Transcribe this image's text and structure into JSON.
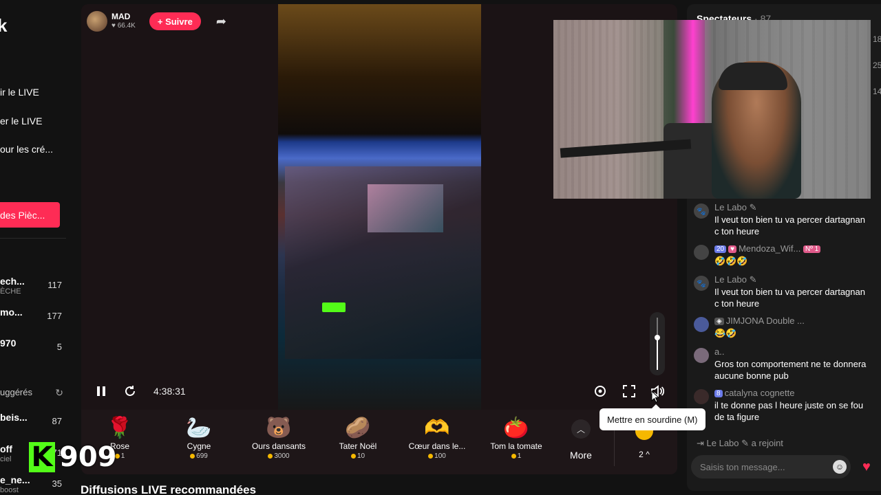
{
  "sidebar": {
    "logo": "k",
    "nav": [
      "ir le LIVE",
      "er le LIVE",
      "our les cré..."
    ],
    "coins_button": "des Pièc...",
    "accounts": [
      {
        "name": "ech...",
        "sub": "ÈCHE",
        "count": "117"
      },
      {
        "name": "mo...",
        "sub": "",
        "count": "177"
      },
      {
        "name": "970",
        "sub": "",
        "count": "5"
      }
    ],
    "suggested_label": "uggérés",
    "suggested": [
      {
        "name": "beis...",
        "sub": "",
        "count": "87"
      },
      {
        "name": "off",
        "sub": "ciel",
        "count": "71"
      },
      {
        "name": "e_ne...",
        "sub": "boost",
        "count": "35"
      }
    ]
  },
  "watermark": {
    "letter": "K",
    "number": "909"
  },
  "player": {
    "host_name": "MAD",
    "host_likes": "66.4K",
    "follow_label": "+ Suivre",
    "elapsed": "4:38:31",
    "volume": 0.62,
    "mute_tooltip": "Mettre en sourdine (M)"
  },
  "gifts": [
    {
      "name": "Rose",
      "price": "1",
      "icon": "🌹"
    },
    {
      "name": "Cygne",
      "price": "699",
      "icon": "🦢"
    },
    {
      "name": "Ours dansants",
      "price": "3000",
      "icon": "🐻"
    },
    {
      "name": "Tater Noël",
      "price": "10",
      "icon": "🥔"
    },
    {
      "name": "Cœur dans le...",
      "price": "100",
      "icon": "🫶"
    },
    {
      "name": "Tom la tomate",
      "price": "1",
      "icon": "🍅"
    }
  ],
  "gift_more_label": "More",
  "rank_label": "2",
  "section_title": "Diffusions LIVE recommandées",
  "chat": {
    "viewers_label": "Spectateurs",
    "viewers_count": "· 87",
    "right_numbers": [
      "18",
      "25",
      "14"
    ],
    "messages": [
      {
        "user": "Le Labo",
        "text": "Il veut ton bien tu va percer dartagnan c ton heure"
      },
      {
        "user": "Mendoza_Wif...",
        "badge_level": "20",
        "badge_rank": "Nº 1",
        "text": "🤣🤣🤣"
      },
      {
        "user": "Le Labo",
        "text": "Il veut ton bien tu va percer dartagnan c ton heure"
      },
      {
        "user": "JIMJONA",
        "suffix": "Double ...",
        "text": "😂🤣"
      },
      {
        "user": "a..",
        "text": "Gros ton comportement ne te donnera aucune bonne pub"
      },
      {
        "user": "catalyna cognette",
        "badge_level": "8",
        "text": "il te donne pas l heure juste on se fou de ta figure"
      }
    ],
    "joined_user": "Le Labo",
    "joined_text": "a rejoint",
    "input_placeholder": "Saisis ton message..."
  },
  "colors": {
    "accent": "#fe2c55",
    "kick_green": "#53fc18",
    "coin": "#f5b800"
  }
}
